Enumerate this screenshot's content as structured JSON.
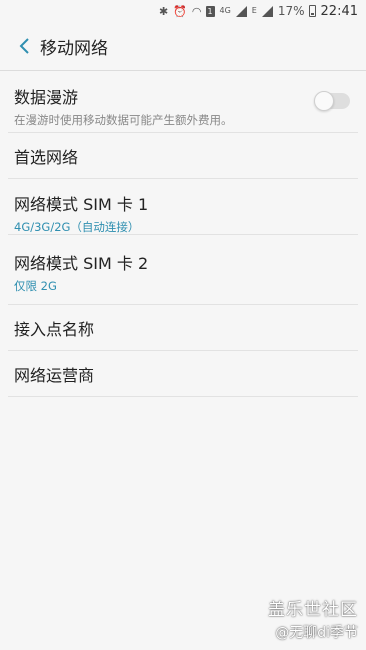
{
  "status_bar": {
    "icons": [
      "bluetooth-icon",
      "alarm-icon",
      "wifi-icon",
      "sim1-icon",
      "4g-icon",
      "signal-icon",
      "e-icon",
      "signal2-icon"
    ],
    "sim_label": "1",
    "net_label_1": "4G",
    "net_label_2": "E",
    "battery": "17%",
    "time": "22:41"
  },
  "header": {
    "title": "移动网络"
  },
  "settings": {
    "roaming": {
      "title": "数据漫游",
      "subtitle": "在漫游时使用移动数据可能产生额外费用。",
      "enabled": false
    },
    "preferred": {
      "title": "首选网络"
    },
    "sim1_mode": {
      "title": "网络模式 SIM 卡 1",
      "value": "4G/3G/2G（自动连接）"
    },
    "sim2_mode": {
      "title": "网络模式 SIM 卡 2",
      "value": "仅限 2G"
    },
    "apn": {
      "title": "接入点名称"
    },
    "operators": {
      "title": "网络运营商"
    }
  },
  "watermark": {
    "line1": "盖乐世社区",
    "line2": "@无聊di季节"
  },
  "colors": {
    "accent": "#2f8fb0",
    "background": "#f6f6f6"
  }
}
